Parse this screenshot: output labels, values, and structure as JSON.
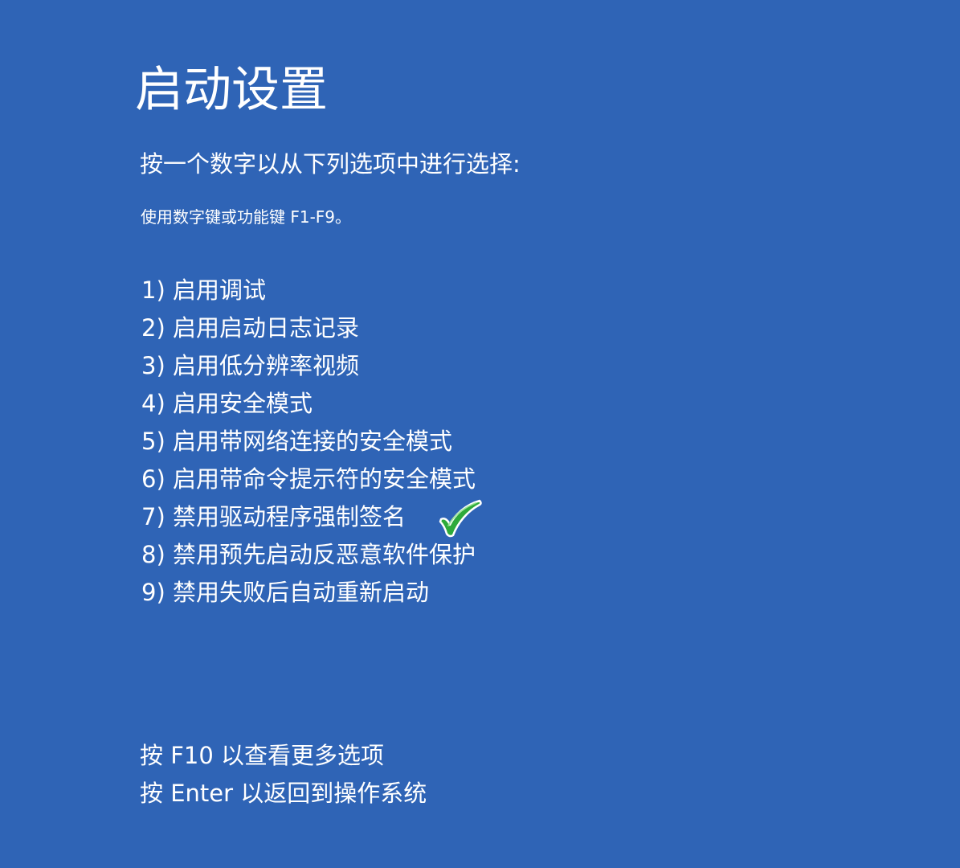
{
  "screen": {
    "title": "启动设置",
    "subtitle": "按一个数字以从下列选项中进行选择:",
    "hint": "使用数字键或功能键 F1-F9。"
  },
  "options": [
    {
      "label": "1) 启用调试"
    },
    {
      "label": "2) 启用启动日志记录"
    },
    {
      "label": "3) 启用低分辨率视频"
    },
    {
      "label": "4) 启用安全模式"
    },
    {
      "label": "5) 启用带网络连接的安全模式"
    },
    {
      "label": "6) 启用带命令提示符的安全模式"
    },
    {
      "label": "7) 禁用驱动程序强制签名",
      "marked": true
    },
    {
      "label": "8) 禁用预先启动反恶意软件保护"
    },
    {
      "label": "9) 禁用失败后自动重新启动"
    }
  ],
  "footer": {
    "more_options": "按 F10 以查看更多选项",
    "return_os": "按 Enter 以返回到操作系统"
  },
  "colors": {
    "background": "#2f64b6",
    "text": "#ffffff",
    "checkmark": "#2eaa3a"
  },
  "icons": {
    "checkmark": "green-checkmark-icon"
  }
}
